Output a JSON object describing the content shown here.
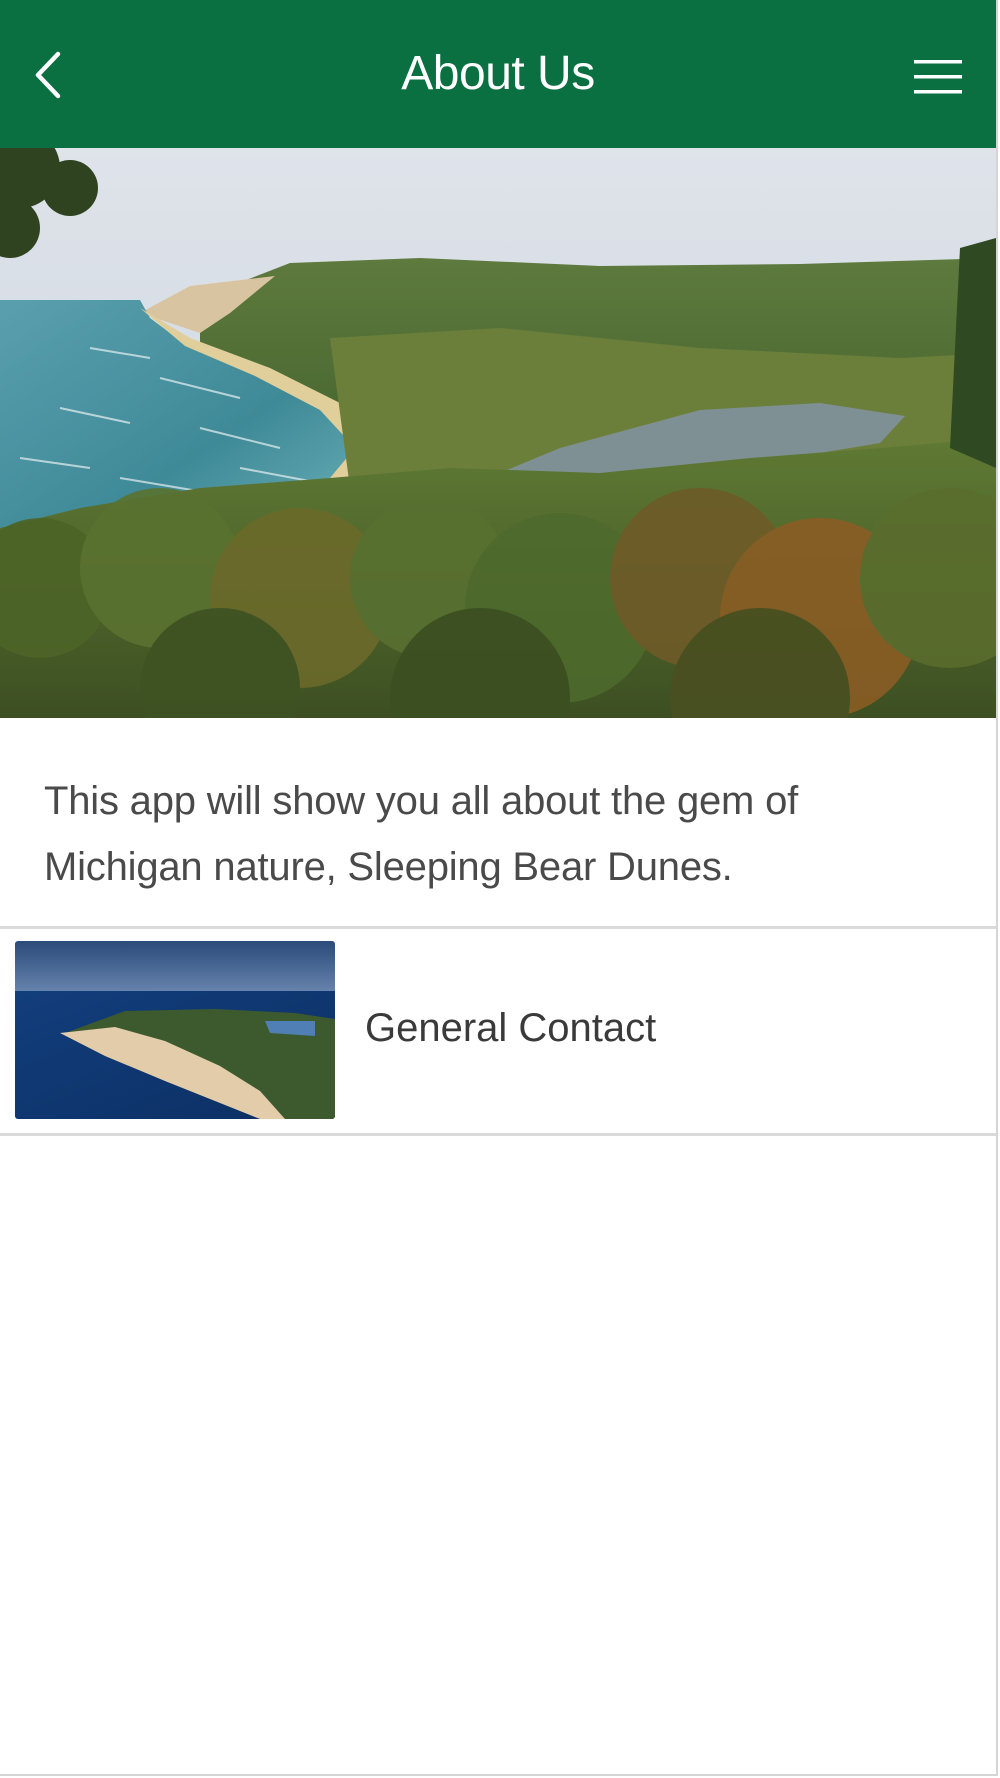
{
  "header": {
    "title": "About Us",
    "back_icon": "chevron-left-icon",
    "menu_icon": "hamburger-menu-icon",
    "background_color": "#0a7041",
    "text_color": "#ffffff"
  },
  "hero": {
    "image": "landscape-photo"
  },
  "intro": {
    "text": "This app will show you all about the gem of Michigan nature, Sleeping Bear Dunes."
  },
  "list": {
    "items": [
      {
        "label": "General Contact",
        "thumbnail": "aerial-dunes-photo"
      }
    ]
  }
}
